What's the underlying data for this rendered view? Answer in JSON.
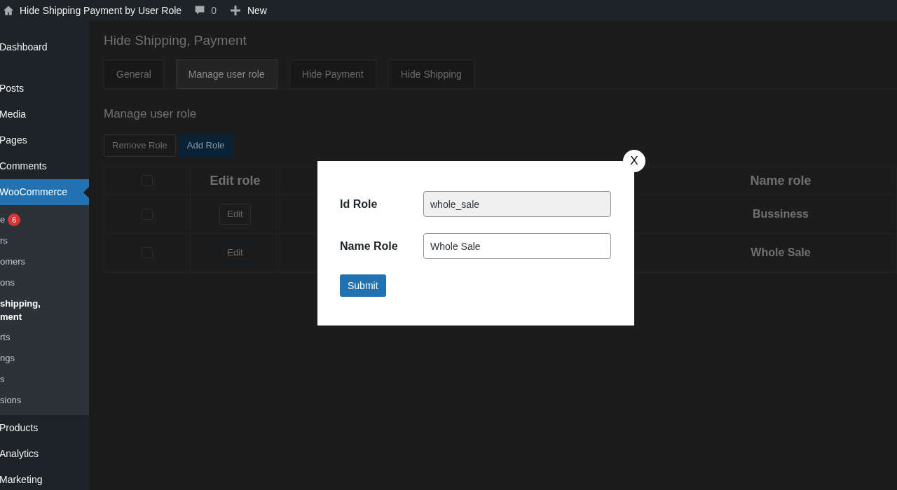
{
  "top_bar": {
    "site_title": "Hide Shipping Payment by User Role",
    "comments_count": "0",
    "new_label": "New"
  },
  "sidebar": {
    "items": [
      {
        "label": "Dashboard",
        "selected": false
      },
      {
        "label": "Posts",
        "selected": false
      },
      {
        "label": "Media",
        "selected": false
      },
      {
        "label": "Pages",
        "selected": false
      },
      {
        "label": "Comments",
        "selected": false
      },
      {
        "label": "WooCommerce",
        "selected": true,
        "children": [
          {
            "label": "e",
            "badge": "6",
            "selected": false
          },
          {
            "label": "rs",
            "selected": false
          },
          {
            "label": "omers",
            "selected": false
          },
          {
            "label": "ons",
            "selected": false
          },
          {
            "label": "shipping,\nment",
            "selected": true
          },
          {
            "label": "rts",
            "selected": false
          },
          {
            "label": "ngs",
            "selected": false
          },
          {
            "label": "s",
            "selected": false
          },
          {
            "label": "sions",
            "selected": false
          }
        ]
      },
      {
        "label": "Products",
        "selected": false
      },
      {
        "label": "Analytics",
        "selected": false
      },
      {
        "label": "Marketing",
        "selected": false
      }
    ]
  },
  "page": {
    "title": "Hide Shipping, Payment",
    "tabs": [
      {
        "label": "General",
        "selected": false
      },
      {
        "label": "Manage user role",
        "selected": true
      },
      {
        "label": "Hide Payment",
        "selected": false
      },
      {
        "label": "Hide Shipping",
        "selected": false
      }
    ],
    "section_title": "Manage user role",
    "buttons": [
      {
        "label": "Remove Role",
        "kind": "secondary"
      },
      {
        "label": "Add Role",
        "kind": "primary"
      }
    ],
    "table": {
      "header_checked": false,
      "columns": [
        "Edit role",
        "Name role"
      ],
      "rows": [
        {
          "checked": false,
          "edit": "Edit",
          "name": "Bussiness"
        },
        {
          "checked": false,
          "edit": "Edit",
          "name": "Whole Sale"
        }
      ]
    }
  },
  "modal": {
    "close": "X",
    "fields": [
      {
        "label": "Id Role",
        "value": "whole_sale",
        "disabled": true
      },
      {
        "label": "Name Role",
        "value": "Whole Sale",
        "disabled": false
      }
    ],
    "submit": "Submit"
  }
}
